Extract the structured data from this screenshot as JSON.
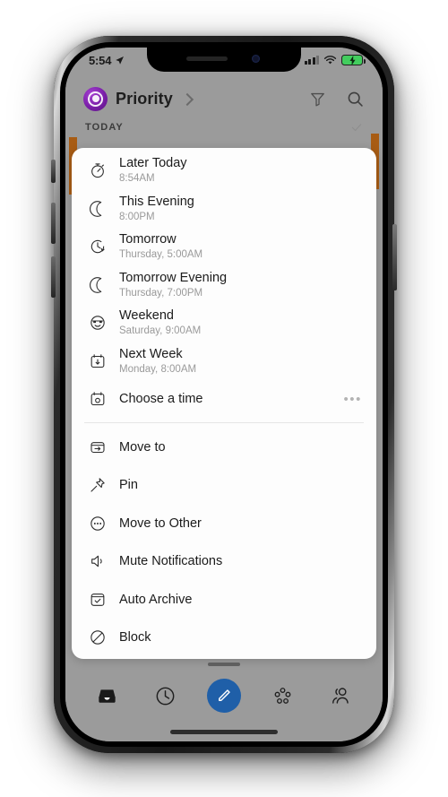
{
  "status_bar": {
    "time": "5:54",
    "location_icon": "location-arrow-icon",
    "cellular_icon": "cellular-bars-icon",
    "wifi_icon": "wifi-icon",
    "battery_icon": "battery-charging-icon",
    "battery_color": "#43cd5e"
  },
  "header": {
    "logo_icon": "app-logo-icon",
    "title": "Priority",
    "chevron_icon": "chevron-right-icon",
    "filter_icon": "filter-icon",
    "search_icon": "search-icon"
  },
  "section": {
    "label": "TODAY",
    "check_icon": "checkmark-icon"
  },
  "accent": {
    "swipe_color": "#a85c14",
    "compose_color": "#1f5fa8",
    "brand_color": "#7a1fa8"
  },
  "sheet": {
    "snooze_items": [
      {
        "icon": "stopwatch-icon",
        "title": "Later Today",
        "subtitle": "8:54AM"
      },
      {
        "icon": "moon-icon",
        "title": "This Evening",
        "subtitle": "8:00PM"
      },
      {
        "icon": "clock-arrow-icon",
        "title": "Tomorrow",
        "subtitle": "Thursday, 5:00AM"
      },
      {
        "icon": "moon-icon",
        "title": "Tomorrow Evening",
        "subtitle": "Thursday, 7:00PM"
      },
      {
        "icon": "sunglasses-face-icon",
        "title": "Weekend",
        "subtitle": "Saturday, 9:00AM"
      },
      {
        "icon": "calendar-down-icon",
        "title": "Next Week",
        "subtitle": "Monday, 8:00AM"
      }
    ],
    "choose_time": {
      "icon": "calendar-clock-icon",
      "title": "Choose a time",
      "more_icon": "ellipsis-icon",
      "more_label": "•••"
    },
    "action_items": [
      {
        "icon": "move-to-icon",
        "title": "Move to"
      },
      {
        "icon": "pin-icon",
        "title": "Pin"
      },
      {
        "icon": "circle-dots-icon",
        "title": "Move to Other"
      },
      {
        "icon": "mute-speaker-icon",
        "title": "Mute Notifications"
      },
      {
        "icon": "archive-check-icon",
        "title": "Auto Archive"
      },
      {
        "icon": "block-icon",
        "title": "Block"
      }
    ]
  },
  "tabbar": {
    "items": [
      {
        "icon": "inbox-icon",
        "name": "tab-inbox",
        "active": true
      },
      {
        "icon": "clock-icon",
        "name": "tab-snoozed",
        "active": false
      },
      {
        "icon": "compose-pencil-icon",
        "name": "tab-compose",
        "active": false
      },
      {
        "icon": "groups-icon",
        "name": "tab-groups",
        "active": false
      },
      {
        "icon": "people-icon",
        "name": "tab-people",
        "active": false
      }
    ]
  }
}
